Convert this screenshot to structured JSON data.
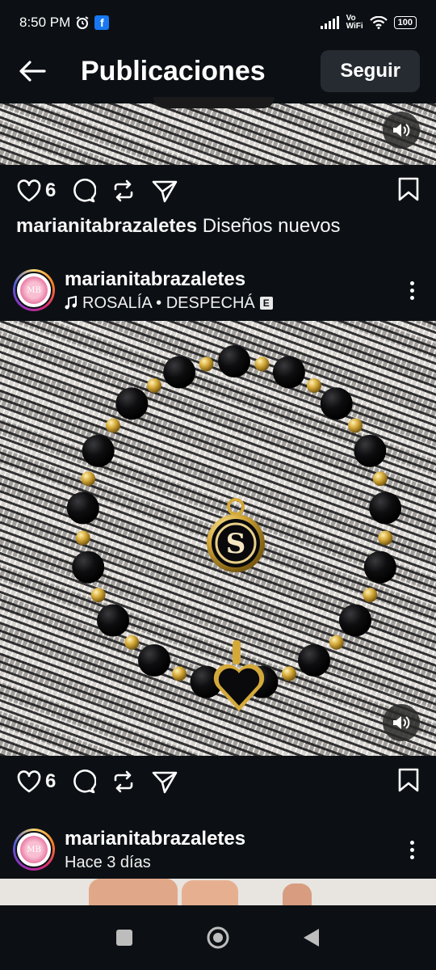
{
  "status_bar": {
    "time": "8:50 PM",
    "volte_top": "Vo",
    "volte_bottom": "WiFi",
    "battery": "100"
  },
  "header": {
    "title": "Publicaciones",
    "follow_label": "Seguir"
  },
  "post1": {
    "likes": "6",
    "caption_user": "marianitabrazaletes",
    "caption_text": " Diseños nuevos"
  },
  "post2": {
    "username": "marianitabrazaletes",
    "music": "ROSALÍA • DESPECHÁ",
    "explicit": "E",
    "avatar_text": "MB",
    "likes": "6",
    "pendant_letter": "S"
  },
  "post3": {
    "username": "marianitabrazaletes",
    "time_ago": "Hace 3 días",
    "avatar_text": "MB"
  },
  "icons": {
    "back": "arrow-left-icon",
    "like": "heart-icon",
    "comment": "comment-icon",
    "repost": "repost-icon",
    "share": "send-icon",
    "save": "bookmark-icon",
    "sound": "speaker-icon",
    "more": "more-vertical-icon",
    "music": "music-note-icon",
    "nav_recent": "square-icon",
    "nav_home": "circle-icon",
    "nav_back": "triangle-back-icon"
  },
  "colors": {
    "background": "#0c1014",
    "follow_button": "#262b31",
    "gold": "#d4a93a",
    "bead": "#0a0a0c"
  }
}
